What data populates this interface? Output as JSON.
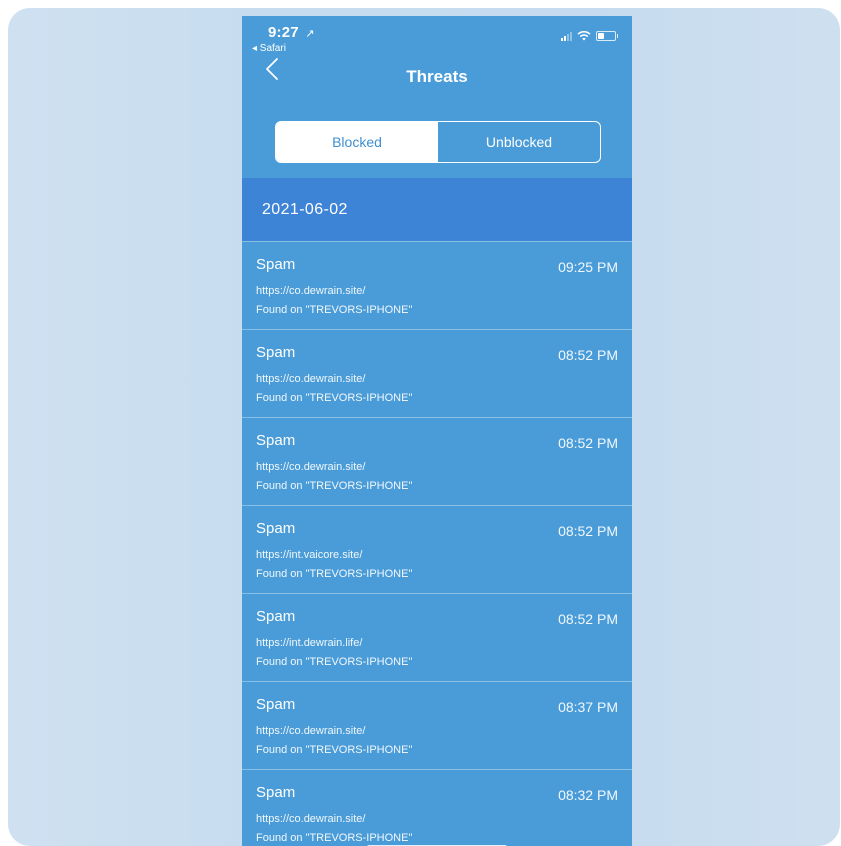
{
  "status_bar": {
    "time": "9:27",
    "location_arrow": "↗",
    "back_app": "◂ Safari"
  },
  "nav": {
    "title": "Threats",
    "back_icon": "chevron-left-icon"
  },
  "segments": {
    "blocked": "Blocked",
    "unblocked": "Unblocked",
    "selected": "Blocked"
  },
  "date_header": "2021-06-02",
  "threats": [
    {
      "type": "Spam",
      "time": "09:25 PM",
      "url": "https://co.dewrain.site/",
      "device": "Found on \"TREVORS-IPHONE\""
    },
    {
      "type": "Spam",
      "time": "08:52 PM",
      "url": "https://co.dewrain.site/",
      "device": "Found on \"TREVORS-IPHONE\""
    },
    {
      "type": "Spam",
      "time": "08:52 PM",
      "url": "https://co.dewrain.site/",
      "device": "Found on \"TREVORS-IPHONE\""
    },
    {
      "type": "Spam",
      "time": "08:52 PM",
      "url": "https://int.vaicore.site/",
      "device": "Found on \"TREVORS-IPHONE\""
    },
    {
      "type": "Spam",
      "time": "08:52 PM",
      "url": "https://int.dewrain.life/",
      "device": "Found on \"TREVORS-IPHONE\""
    },
    {
      "type": "Spam",
      "time": "08:37 PM",
      "url": "https://co.dewrain.site/",
      "device": "Found on \"TREVORS-IPHONE\""
    },
    {
      "type": "Spam",
      "time": "08:32 PM",
      "url": "https://co.dewrain.site/",
      "device": "Found on \"TREVORS-IPHONE\""
    }
  ],
  "colors": {
    "background": "#4a9cd8",
    "date_header": "#3e84d6",
    "accent": "#3f8fd0"
  }
}
